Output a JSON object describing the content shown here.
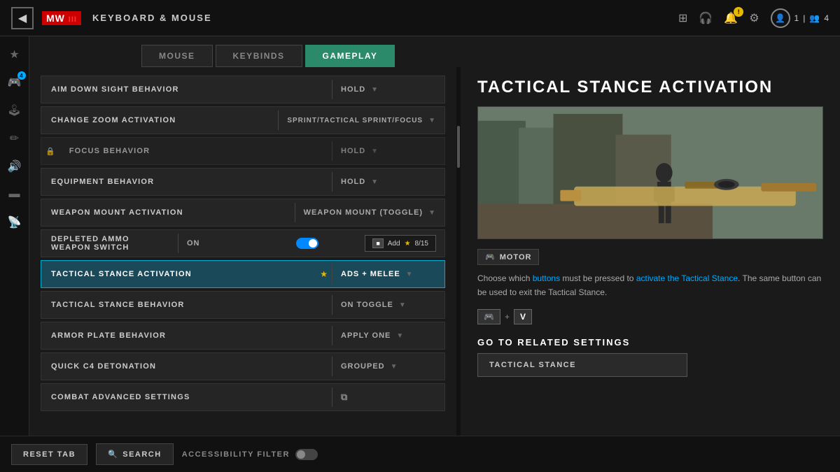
{
  "header": {
    "back_icon": "◀",
    "logo_text": "MW",
    "logo_sub": "III",
    "title": "KEYBOARD & MOUSE",
    "icons": [
      {
        "name": "grid-icon",
        "symbol": "⊞",
        "badge": null
      },
      {
        "name": "headphone-icon",
        "symbol": "🎧",
        "badge": null
      },
      {
        "name": "bell-icon",
        "symbol": "🔔",
        "badge": "!"
      },
      {
        "name": "gear-icon",
        "symbol": "⚙",
        "badge": null
      }
    ],
    "profile": {
      "icon": "👤",
      "level": "1",
      "separator": "|",
      "friends_icon": "👥",
      "friends_count": "4"
    }
  },
  "sidebar": {
    "icons": [
      {
        "name": "star-icon",
        "symbol": "★",
        "active": false
      },
      {
        "name": "controller-icon",
        "symbol": "🎮",
        "active": true,
        "badge": "4"
      },
      {
        "name": "gamepad-icon",
        "symbol": "🕹",
        "active": false
      },
      {
        "name": "pencil-icon",
        "symbol": "✏",
        "active": false
      },
      {
        "name": "volume-icon",
        "symbol": "🔊",
        "active": false
      },
      {
        "name": "display-icon",
        "symbol": "▬",
        "active": false
      },
      {
        "name": "network-icon",
        "symbol": "📡",
        "active": false
      }
    ]
  },
  "tabs": [
    {
      "label": "MOUSE",
      "active": false
    },
    {
      "label": "KEYBINDS",
      "active": false
    },
    {
      "label": "GAMEPLAY",
      "active": true
    }
  ],
  "settings": [
    {
      "name": "AIM DOWN SIGHT BEHAVIOR",
      "value": "HOLD",
      "locked": false,
      "starred": false,
      "active": false
    },
    {
      "name": "CHANGE ZOOM ACTIVATION",
      "value": "SPRINT/TACTICAL SPRINT/FOCUS",
      "locked": false,
      "starred": false,
      "active": false
    },
    {
      "name": "FOCUS BEHAVIOR",
      "value": "HOLD",
      "locked": true,
      "starred": false,
      "active": false
    },
    {
      "name": "EQUIPMENT BEHAVIOR",
      "value": "HOLD",
      "locked": false,
      "starred": false,
      "active": false
    },
    {
      "name": "WEAPON MOUNT ACTIVATION",
      "value": "WEAPON MOUNT (TOGGLE)",
      "locked": false,
      "starred": false,
      "active": false
    },
    {
      "name": "DEPLETED AMMO WEAPON SWITCH",
      "value": "ON",
      "locked": false,
      "starred": false,
      "active": false,
      "has_toggle": true
    },
    {
      "name": "TACTICAL STANCE ACTIVATION",
      "value": "ADS + MELEE",
      "locked": false,
      "starred": true,
      "active": true
    },
    {
      "name": "TACTICAL STANCE BEHAVIOR",
      "value": "ON TOGGLE",
      "locked": false,
      "starred": false,
      "active": false
    },
    {
      "name": "ARMOR PLATE BEHAVIOR",
      "value": "APPLY ONE",
      "locked": false,
      "starred": false,
      "active": false
    },
    {
      "name": "QUICK C4 DETONATION",
      "value": "GROUPED",
      "locked": false,
      "starred": false,
      "active": false
    },
    {
      "name": "COMBAT ADVANCED SETTINGS",
      "value": "",
      "locked": false,
      "starred": false,
      "active": false,
      "has_external": true
    }
  ],
  "popup": {
    "btn_label": "Add",
    "star_symbol": "★",
    "count": "8/15"
  },
  "right_panel": {
    "title": "TACTICAL STANCE ACTIVATION",
    "motor_label": "MOTOR",
    "description_part1": "Choose which ",
    "description_link1": "buttons",
    "description_part2": " must be pressed to ",
    "description_link2": "activate the Tactical Stance",
    "description_part3": ". The same button can be used to exit the Tactical Stance.",
    "key1": "🎮",
    "key2": "V",
    "go_related_title": "GO TO RELATED SETTINGS",
    "related_btn_label": "TACTICAL STANCE"
  },
  "bottom_bar": {
    "reset_btn": "RESET TAB",
    "search_btn": "SEARCH",
    "accessibility_label": "ACCESSIBILITY FILTER",
    "reset_key": "",
    "search_key": "🔍"
  }
}
